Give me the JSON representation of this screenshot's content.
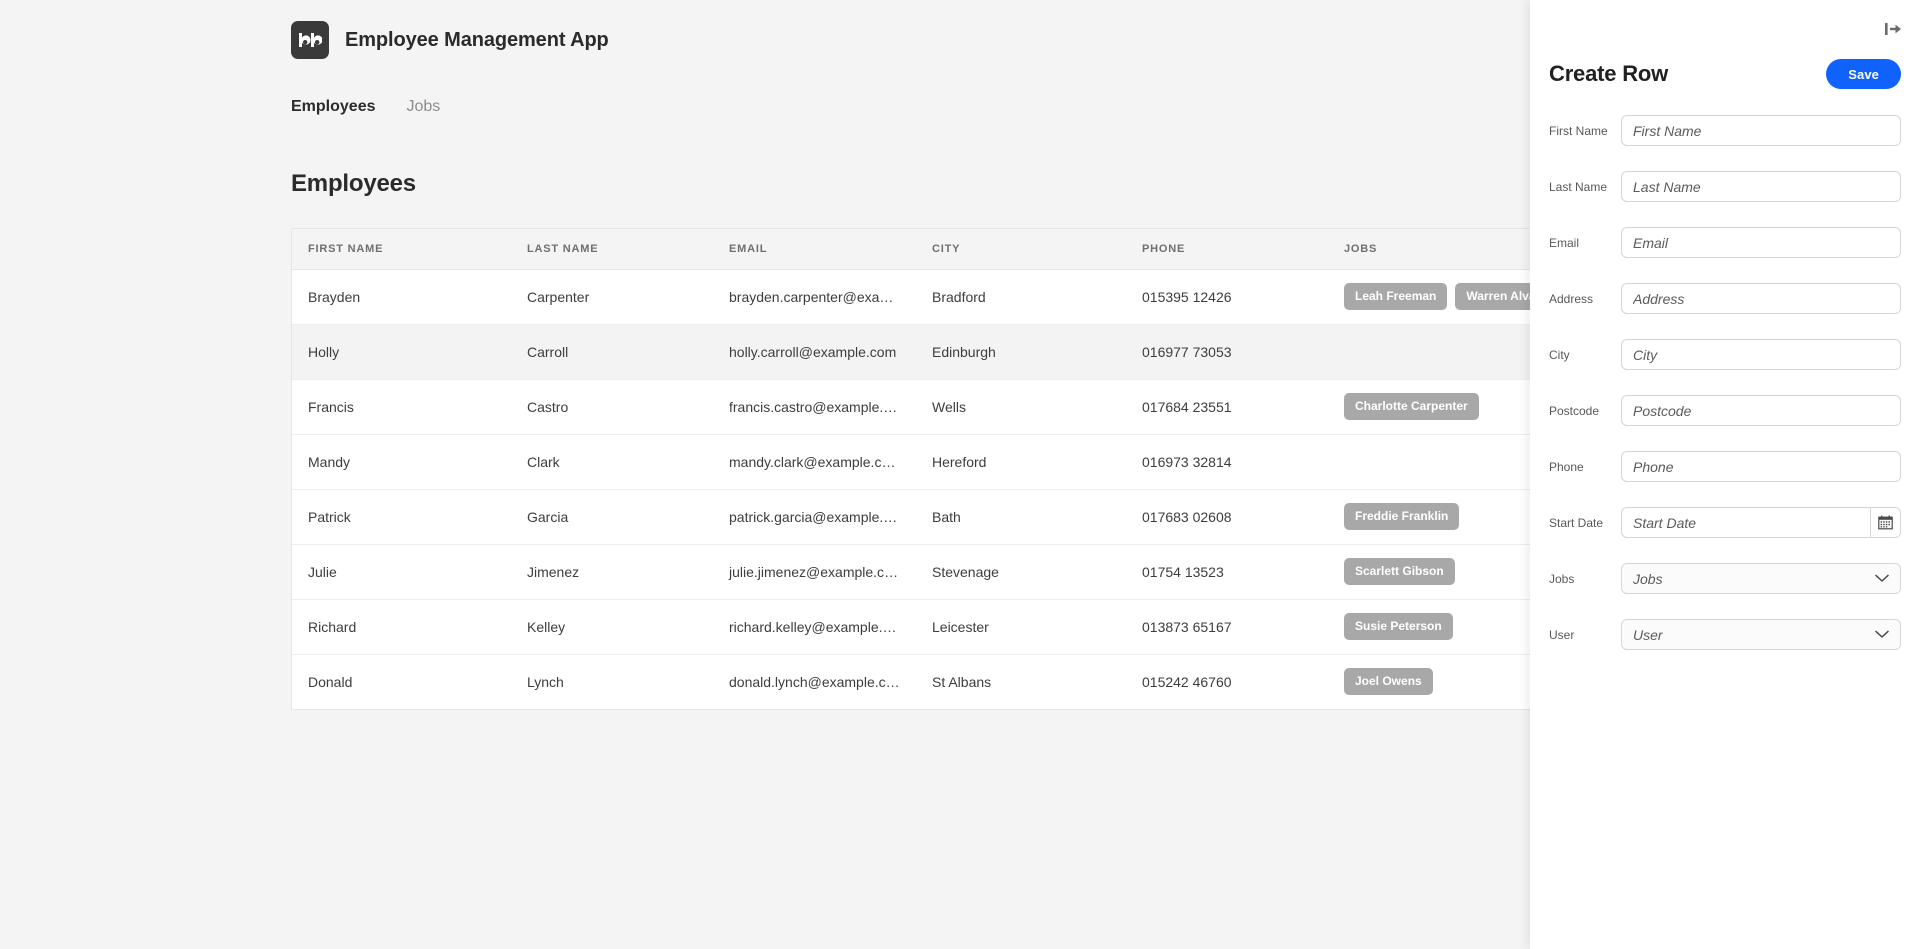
{
  "app": {
    "title": "Employee Management App",
    "logo_icon": "bb-logo-icon"
  },
  "nav": {
    "tabs": [
      {
        "label": "Employees",
        "active": true
      },
      {
        "label": "Jobs",
        "active": false
      }
    ]
  },
  "main": {
    "page_title": "Employees",
    "table": {
      "columns": [
        "FIRST NAME",
        "LAST NAME",
        "EMAIL",
        "CITY",
        "PHONE",
        "JOBS"
      ],
      "rows": [
        {
          "first_name": "Brayden",
          "last_name": "Carpenter",
          "email": "brayden.carpenter@examp…",
          "city": "Bradford",
          "phone": "015395 12426",
          "jobs": [
            "Leah Freeman",
            "Warren Alvarez"
          ],
          "striped": false
        },
        {
          "first_name": "Holly",
          "last_name": "Carroll",
          "email": "holly.carroll@example.com",
          "city": "Edinburgh",
          "phone": "016977 73053",
          "jobs": [],
          "striped": true
        },
        {
          "first_name": "Francis",
          "last_name": "Castro",
          "email": "francis.castro@example.com",
          "city": "Wells",
          "phone": "017684 23551",
          "jobs": [
            "Charlotte Carpenter"
          ],
          "striped": false
        },
        {
          "first_name": "Mandy",
          "last_name": "Clark",
          "email": "mandy.clark@example.com",
          "city": "Hereford",
          "phone": "016973 32814",
          "jobs": [],
          "striped": false
        },
        {
          "first_name": "Patrick",
          "last_name": "Garcia",
          "email": "patrick.garcia@example.com",
          "city": "Bath",
          "phone": "017683 02608",
          "jobs": [
            "Freddie Franklin"
          ],
          "striped": false
        },
        {
          "first_name": "Julie",
          "last_name": "Jimenez",
          "email": "julie.jimenez@example.com",
          "city": "Stevenage",
          "phone": "01754 13523",
          "jobs": [
            "Scarlett Gibson"
          ],
          "striped": false
        },
        {
          "first_name": "Richard",
          "last_name": "Kelley",
          "email": "richard.kelley@example.com",
          "city": "Leicester",
          "phone": "013873 65167",
          "jobs": [
            "Susie Peterson"
          ],
          "striped": false
        },
        {
          "first_name": "Donald",
          "last_name": "Lynch",
          "email": "donald.lynch@example.com",
          "city": "St Albans",
          "phone": "015242 46760",
          "jobs": [
            "Joel Owens"
          ],
          "striped": false
        }
      ]
    }
  },
  "panel": {
    "collapse_icon": "collapse-panel-right-icon",
    "title": "Create Row",
    "save_label": "Save",
    "fields": [
      {
        "label": "First Name",
        "placeholder": "First Name",
        "value": "",
        "type": "text",
        "name": "first-name"
      },
      {
        "label": "Last Name",
        "placeholder": "Last Name",
        "value": "",
        "type": "text",
        "name": "last-name"
      },
      {
        "label": "Email",
        "placeholder": "Email",
        "value": "",
        "type": "text",
        "name": "email"
      },
      {
        "label": "Address",
        "placeholder": "Address",
        "value": "",
        "type": "text",
        "name": "address"
      },
      {
        "label": "City",
        "placeholder": "City",
        "value": "",
        "type": "text",
        "name": "city"
      },
      {
        "label": "Postcode",
        "placeholder": "Postcode",
        "value": "",
        "type": "text",
        "name": "postcode"
      },
      {
        "label": "Phone",
        "placeholder": "Phone",
        "value": "",
        "type": "text",
        "name": "phone"
      },
      {
        "label": "Start Date",
        "placeholder": "Start Date",
        "value": "",
        "type": "date",
        "name": "start-date",
        "icon": "calendar-icon"
      },
      {
        "label": "Jobs",
        "placeholder": "Jobs",
        "value": "Jobs",
        "type": "select",
        "name": "jobs",
        "icon": "chevron-down-icon"
      },
      {
        "label": "User",
        "placeholder": "User",
        "value": "User",
        "type": "select",
        "name": "user",
        "icon": "chevron-down-icon"
      }
    ]
  },
  "colors": {
    "accent": "#0f62fe",
    "badge": "#a8a8a8",
    "page_bg": "#f4f4f4",
    "panel_bg": "#ffffff"
  }
}
